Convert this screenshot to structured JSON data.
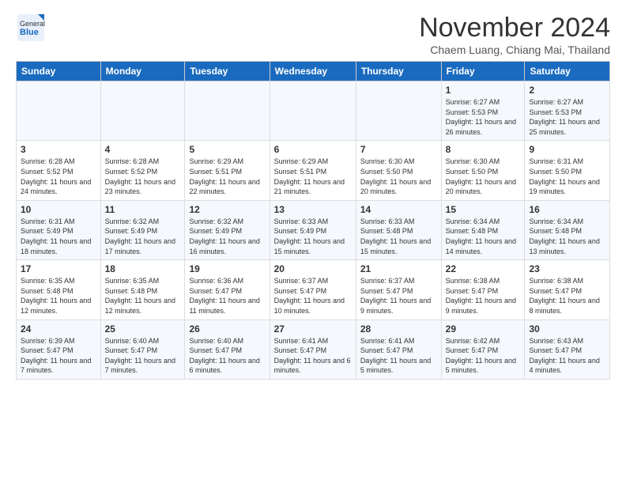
{
  "logo": {
    "general": "General",
    "blue": "Blue"
  },
  "header": {
    "month": "November 2024",
    "location": "Chaem Luang, Chiang Mai, Thailand"
  },
  "days_of_week": [
    "Sunday",
    "Monday",
    "Tuesday",
    "Wednesday",
    "Thursday",
    "Friday",
    "Saturday"
  ],
  "weeks": [
    [
      {
        "day": "",
        "info": ""
      },
      {
        "day": "",
        "info": ""
      },
      {
        "day": "",
        "info": ""
      },
      {
        "day": "",
        "info": ""
      },
      {
        "day": "",
        "info": ""
      },
      {
        "day": "1",
        "info": "Sunrise: 6:27 AM\nSunset: 5:53 PM\nDaylight: 11 hours and 26 minutes."
      },
      {
        "day": "2",
        "info": "Sunrise: 6:27 AM\nSunset: 5:53 PM\nDaylight: 11 hours and 25 minutes."
      }
    ],
    [
      {
        "day": "3",
        "info": "Sunrise: 6:28 AM\nSunset: 5:52 PM\nDaylight: 11 hours and 24 minutes."
      },
      {
        "day": "4",
        "info": "Sunrise: 6:28 AM\nSunset: 5:52 PM\nDaylight: 11 hours and 23 minutes."
      },
      {
        "day": "5",
        "info": "Sunrise: 6:29 AM\nSunset: 5:51 PM\nDaylight: 11 hours and 22 minutes."
      },
      {
        "day": "6",
        "info": "Sunrise: 6:29 AM\nSunset: 5:51 PM\nDaylight: 11 hours and 21 minutes."
      },
      {
        "day": "7",
        "info": "Sunrise: 6:30 AM\nSunset: 5:50 PM\nDaylight: 11 hours and 20 minutes."
      },
      {
        "day": "8",
        "info": "Sunrise: 6:30 AM\nSunset: 5:50 PM\nDaylight: 11 hours and 20 minutes."
      },
      {
        "day": "9",
        "info": "Sunrise: 6:31 AM\nSunset: 5:50 PM\nDaylight: 11 hours and 19 minutes."
      }
    ],
    [
      {
        "day": "10",
        "info": "Sunrise: 6:31 AM\nSunset: 5:49 PM\nDaylight: 11 hours and 18 minutes."
      },
      {
        "day": "11",
        "info": "Sunrise: 6:32 AM\nSunset: 5:49 PM\nDaylight: 11 hours and 17 minutes."
      },
      {
        "day": "12",
        "info": "Sunrise: 6:32 AM\nSunset: 5:49 PM\nDaylight: 11 hours and 16 minutes."
      },
      {
        "day": "13",
        "info": "Sunrise: 6:33 AM\nSunset: 5:49 PM\nDaylight: 11 hours and 15 minutes."
      },
      {
        "day": "14",
        "info": "Sunrise: 6:33 AM\nSunset: 5:48 PM\nDaylight: 11 hours and 15 minutes."
      },
      {
        "day": "15",
        "info": "Sunrise: 6:34 AM\nSunset: 5:48 PM\nDaylight: 11 hours and 14 minutes."
      },
      {
        "day": "16",
        "info": "Sunrise: 6:34 AM\nSunset: 5:48 PM\nDaylight: 11 hours and 13 minutes."
      }
    ],
    [
      {
        "day": "17",
        "info": "Sunrise: 6:35 AM\nSunset: 5:48 PM\nDaylight: 11 hours and 12 minutes."
      },
      {
        "day": "18",
        "info": "Sunrise: 6:35 AM\nSunset: 5:48 PM\nDaylight: 11 hours and 12 minutes."
      },
      {
        "day": "19",
        "info": "Sunrise: 6:36 AM\nSunset: 5:47 PM\nDaylight: 11 hours and 11 minutes."
      },
      {
        "day": "20",
        "info": "Sunrise: 6:37 AM\nSunset: 5:47 PM\nDaylight: 11 hours and 10 minutes."
      },
      {
        "day": "21",
        "info": "Sunrise: 6:37 AM\nSunset: 5:47 PM\nDaylight: 11 hours and 9 minutes."
      },
      {
        "day": "22",
        "info": "Sunrise: 6:38 AM\nSunset: 5:47 PM\nDaylight: 11 hours and 9 minutes."
      },
      {
        "day": "23",
        "info": "Sunrise: 6:38 AM\nSunset: 5:47 PM\nDaylight: 11 hours and 8 minutes."
      }
    ],
    [
      {
        "day": "24",
        "info": "Sunrise: 6:39 AM\nSunset: 5:47 PM\nDaylight: 11 hours and 7 minutes."
      },
      {
        "day": "25",
        "info": "Sunrise: 6:40 AM\nSunset: 5:47 PM\nDaylight: 11 hours and 7 minutes."
      },
      {
        "day": "26",
        "info": "Sunrise: 6:40 AM\nSunset: 5:47 PM\nDaylight: 11 hours and 6 minutes."
      },
      {
        "day": "27",
        "info": "Sunrise: 6:41 AM\nSunset: 5:47 PM\nDaylight: 11 hours and 6 minutes."
      },
      {
        "day": "28",
        "info": "Sunrise: 6:41 AM\nSunset: 5:47 PM\nDaylight: 11 hours and 5 minutes."
      },
      {
        "day": "29",
        "info": "Sunrise: 6:42 AM\nSunset: 5:47 PM\nDaylight: 11 hours and 5 minutes."
      },
      {
        "day": "30",
        "info": "Sunrise: 6:43 AM\nSunset: 5:47 PM\nDaylight: 11 hours and 4 minutes."
      }
    ]
  ]
}
